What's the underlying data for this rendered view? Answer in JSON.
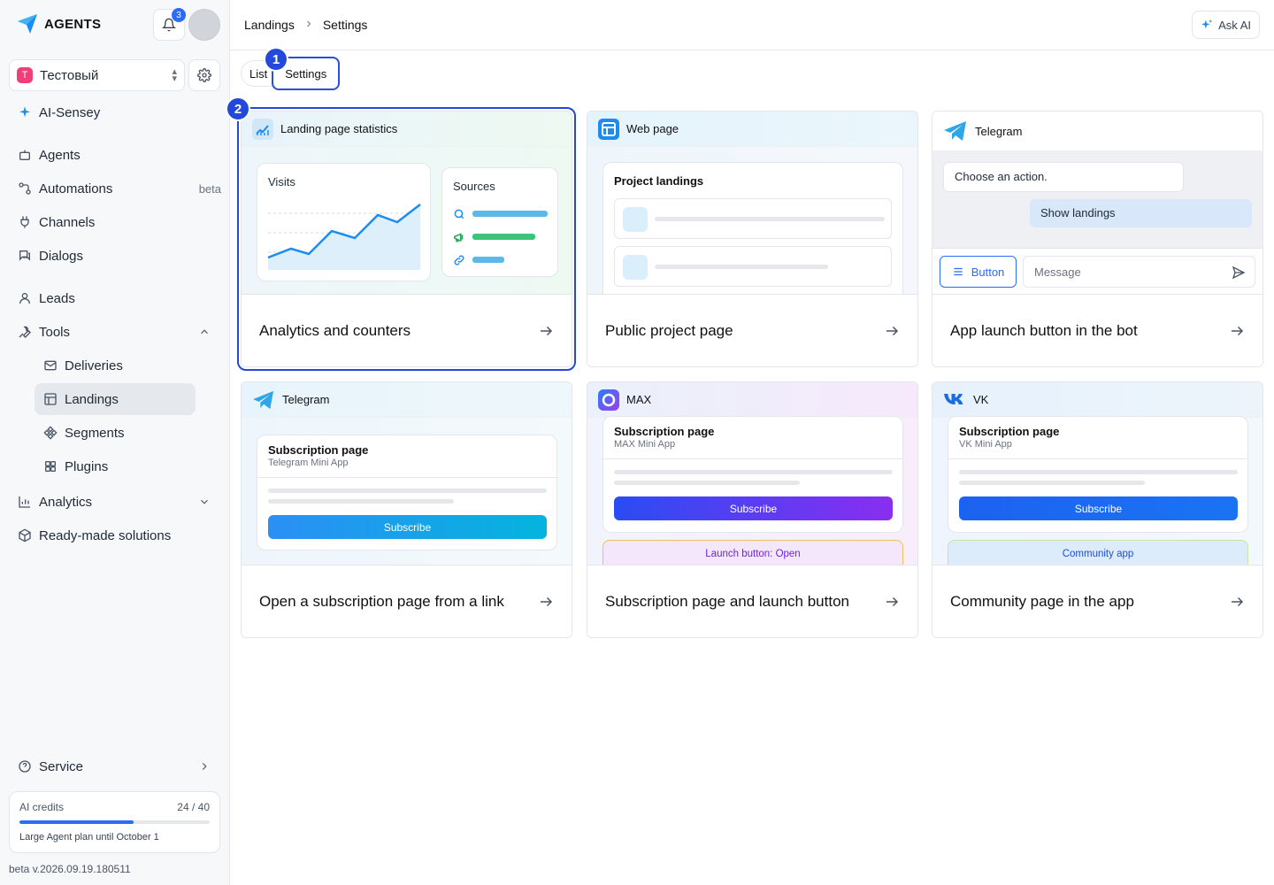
{
  "brand": {
    "name": "AGENTS"
  },
  "notifications": {
    "count": "3"
  },
  "workspace": {
    "initial": "Т",
    "name": "Тестовый"
  },
  "sidebar": {
    "ai": "AI-Sensey",
    "agents": "Agents",
    "automations": "Automations",
    "automations_badge": "beta",
    "channels": "Channels",
    "dialogs": "Dialogs",
    "leads": "Leads",
    "tools": "Tools",
    "deliveries": "Deliveries",
    "landings": "Landings",
    "segments": "Segments",
    "plugins": "Plugins",
    "analytics": "Analytics",
    "solutions": "Ready-made solutions",
    "service": "Service"
  },
  "credits": {
    "label": "AI credits",
    "value": "24 / 40",
    "progress": 0.6,
    "plan": "Large Agent plan until October 1"
  },
  "version": "beta v.2026.09.19.180511",
  "breadcrumb": {
    "first": "Landings",
    "second": "Settings"
  },
  "ask_ai": "Ask AI",
  "tabs": {
    "list": "List",
    "settings": "Settings"
  },
  "markers": {
    "one": "1",
    "two": "2"
  },
  "cards": [
    {
      "header": "Landing page statistics",
      "title": "Analytics and counters",
      "visits": "Visits",
      "sources": "Sources"
    },
    {
      "header": "Web page",
      "title": "Public project page",
      "inner_title": "Project landings"
    },
    {
      "header": "Telegram",
      "title": "App launch button in the bot",
      "prompt": "Choose an action.",
      "reply": "Show landings",
      "button": "Button",
      "message_placeholder": "Message"
    },
    {
      "header": "Telegram",
      "title": "Open a subscription page from a link",
      "inner_title": "Subscription page",
      "inner_sub": "Telegram Mini App",
      "cta": "Subscribe"
    },
    {
      "header": "MAX",
      "title": "Subscription page and launch button",
      "inner_title": "Subscription page",
      "inner_sub": "MAX Mini App",
      "cta": "Subscribe",
      "launch": "Launch button: Open"
    },
    {
      "header": "VK",
      "title": "Community page in the app",
      "inner_title": "Subscription page",
      "inner_sub": "VK Mini App",
      "cta": "Subscribe",
      "launch": "Community app"
    }
  ]
}
